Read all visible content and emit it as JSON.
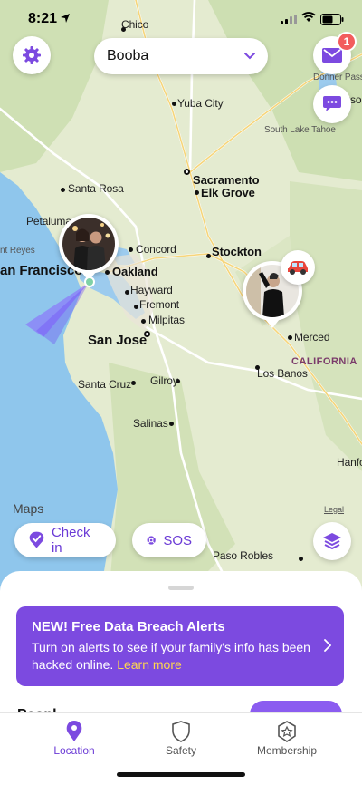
{
  "status_bar": {
    "time": "8:21"
  },
  "header": {
    "circle_name": "Booba",
    "unread_count": "1"
  },
  "map": {
    "places": {
      "chico": "Chico",
      "yuba_city": "Yuba City",
      "carson_city": "Carson City",
      "donner_pass": "Donner Pass",
      "south_lake_tahoe": "South Lake Tahoe",
      "sacramento": "Sacramento",
      "elk_grove": "Elk Grove",
      "santa_rosa": "Santa Rosa",
      "petaluma": "Petaluma",
      "point_reyes": "nt Reyes",
      "concord": "Concord",
      "stockton": "Stockton",
      "san_francisco": "an Francisco",
      "oakland": "Oakland",
      "hayward": "Hayward",
      "fremont": "Fremont",
      "milpitas": "Milpitas",
      "san_jose": "San Jose",
      "merced": "Merced",
      "california": "CALIFORNIA",
      "santa_cruz": "Santa Cruz",
      "gilroy": "Gilroy",
      "los_banos": "Los Banos",
      "salinas": "Salinas",
      "hanford": "Hanfo",
      "paso_robles": "Paso Robles"
    },
    "attribution": "Maps",
    "legal": "Legal"
  },
  "actions": {
    "check_in": "Check in",
    "sos": "SOS"
  },
  "promo": {
    "title": "NEW! Free Data Breach Alerts",
    "body": "Turn on alerts to see if your family's info has been hacked online.",
    "link": "Learn more"
  },
  "sheet": {
    "peek_heading": "Peopl"
  },
  "tabs": [
    {
      "label": "Location",
      "icon": "location-pin-icon",
      "active": true
    },
    {
      "label": "Safety",
      "icon": "shield-icon",
      "active": false
    },
    {
      "label": "Membership",
      "icon": "star-badge-icon",
      "active": false
    }
  ],
  "colors": {
    "brand": "#7c4ae0",
    "brand_text": "#6b3bd6",
    "badge": "#f25c5c",
    "link_accent": "#ffd84d"
  }
}
